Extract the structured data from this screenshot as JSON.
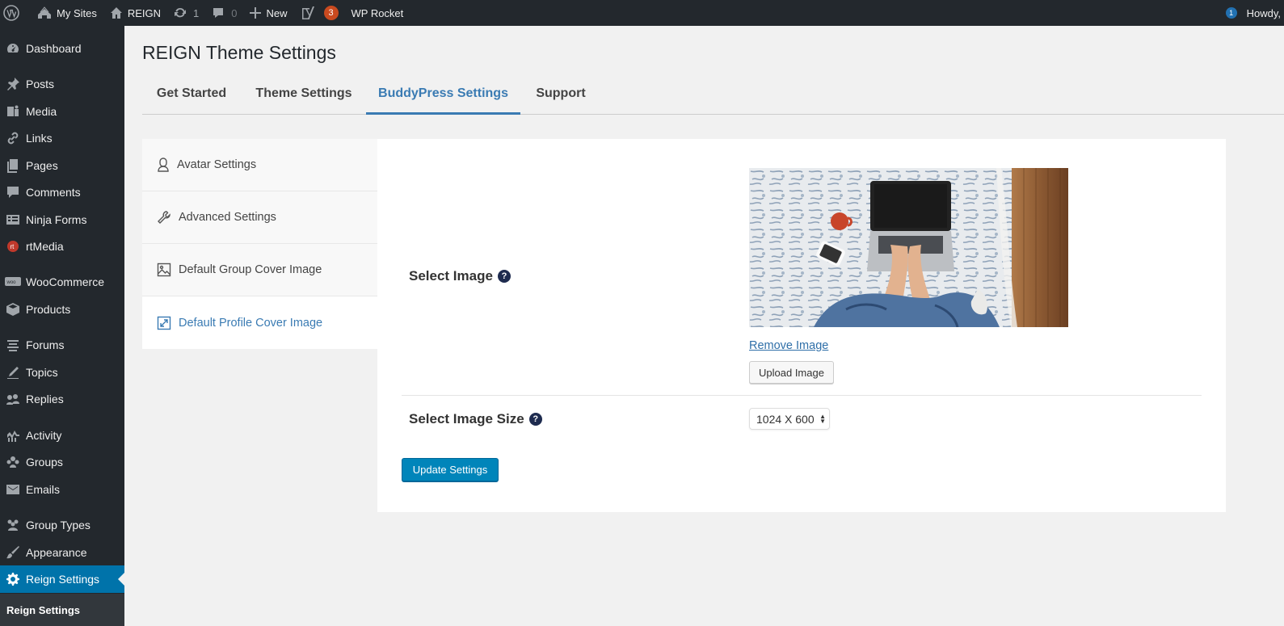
{
  "admin_bar": {
    "my_sites": "My Sites",
    "site_name": "REIGN",
    "updates_count": "1",
    "comments_count": "0",
    "new_label": "New",
    "yoast_count": "3",
    "wp_rocket": "WP Rocket",
    "notif_count": "1",
    "howdy": "Howdy,"
  },
  "sidebar": {
    "items": [
      {
        "label": "Dashboard",
        "icon": "dashboard-icon"
      },
      {
        "label": "Posts",
        "icon": "pin-icon"
      },
      {
        "label": "Media",
        "icon": "media-icon"
      },
      {
        "label": "Links",
        "icon": "link-icon"
      },
      {
        "label": "Pages",
        "icon": "pages-icon"
      },
      {
        "label": "Comments",
        "icon": "comment-icon"
      },
      {
        "label": "Ninja Forms",
        "icon": "forms-icon"
      },
      {
        "label": "rtMedia",
        "icon": "rtmedia-icon"
      },
      {
        "label": "WooCommerce",
        "icon": "woo-icon"
      },
      {
        "label": "Products",
        "icon": "box-icon"
      },
      {
        "label": "Forums",
        "icon": "forums-icon"
      },
      {
        "label": "Topics",
        "icon": "topics-icon"
      },
      {
        "label": "Replies",
        "icon": "replies-icon"
      },
      {
        "label": "Activity",
        "icon": "activity-icon"
      },
      {
        "label": "Groups",
        "icon": "groups-icon"
      },
      {
        "label": "Emails",
        "icon": "email-icon"
      },
      {
        "label": "Group Types",
        "icon": "group-types-icon"
      },
      {
        "label": "Appearance",
        "icon": "brush-icon"
      },
      {
        "label": "Reign Settings",
        "icon": "gear-icon"
      }
    ],
    "submenu_label": "Reign Settings"
  },
  "page": {
    "title": "REIGN Theme Settings",
    "tabs": [
      "Get Started",
      "Theme Settings",
      "BuddyPress Settings",
      "Support"
    ],
    "active_tab": "BuddyPress Settings"
  },
  "settings_nav": {
    "items": [
      "Avatar Settings",
      "Advanced Settings",
      "Default Group Cover Image",
      "Default Profile Cover Image"
    ],
    "active": "Default Profile Cover Image"
  },
  "form": {
    "select_image_label": "Select Image",
    "help_glyph": "?",
    "remove_image": "Remove Image",
    "upload_image": "Upload Image",
    "select_size_label": "Select Image Size",
    "size_value": "1024 X 600",
    "update_button": "Update Settings"
  },
  "colors": {
    "admin_dark": "#23282d",
    "accent": "#0073aa",
    "tab_active": "#3a7bb3",
    "badge": "#ca4a1f"
  }
}
